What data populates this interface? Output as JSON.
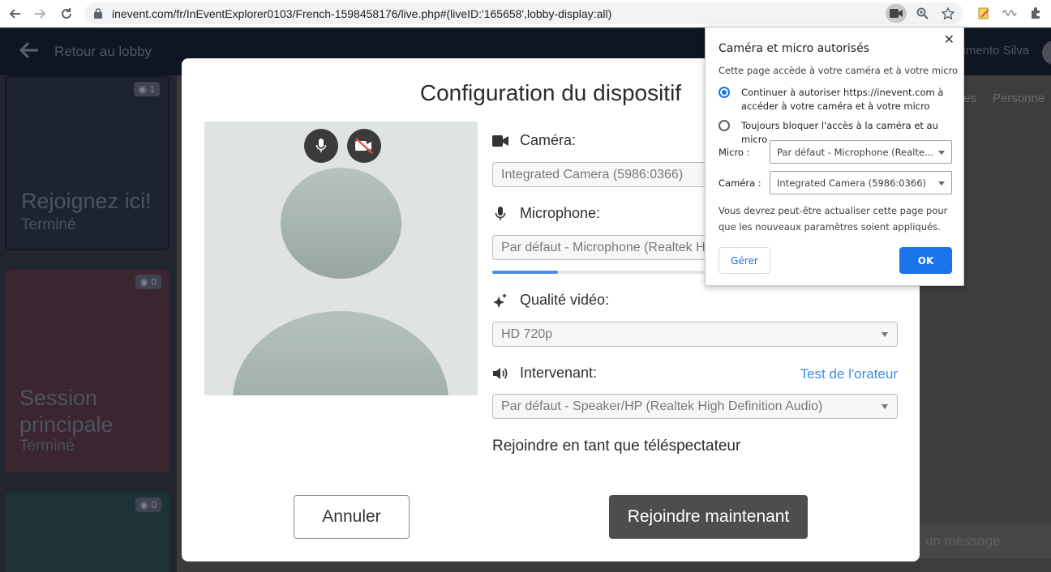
{
  "browser": {
    "url": "inevent.com/fr/InEventExplorer0103/French-1598458176/live.php#(liveID:'165658',lobby-display:all)"
  },
  "app": {
    "back_label": "Retour au lobby",
    "user_name": "cimento Silva",
    "rooms": [
      {
        "title": "Rejoignez ici!",
        "status": "Terminé",
        "viewers": "1"
      },
      {
        "title": "Session principale",
        "status": "Terminé",
        "viewers": "0"
      },
      {
        "title": "",
        "status": "",
        "viewers": "0"
      }
    ],
    "tabs": [
      "es",
      "Personne"
    ],
    "message_placeholder": "un message"
  },
  "modal": {
    "title": "Configuration du dispositif",
    "camera_label": "Caméra:",
    "camera_value": "Integrated Camera (5986:0366)",
    "microphone_label": "Microphone:",
    "microphone_value": "Par défaut - Microphone (Realtek Hi",
    "mic_level": 0.27,
    "quality_label": "Qualité vidéo:",
    "quality_value": "HD 720p",
    "speaker_label": "Intervenant:",
    "speaker_test": "Test de l'orateur",
    "speaker_value": "Par défaut - Speaker/HP (Realtek High Definition Audio)",
    "viewer_option": "Rejoindre en tant que téléspectateur",
    "cancel": "Annuler",
    "join": "Rejoindre maintenant"
  },
  "permission": {
    "title": "Caméra et micro autorisés",
    "description": "Cette page accède à votre caméra et à votre micro",
    "option_allow": "Continuer à autoriser https://inevent.com à accéder à votre caméra et à votre micro",
    "option_block": "Toujours bloquer l'accès à la caméra et au micro",
    "micro_label": "Micro :",
    "micro_value": "Par défaut - Microphone (Realte...",
    "camera_label": "Caméra :",
    "camera_value": "Integrated Camera (5986:0366)",
    "note": "Vous devrez peut-être actualiser cette page pour que les nouveaux paramètres soient appliqués.",
    "manage": "Gérer",
    "ok": "OK"
  },
  "colors": {
    "accent": "#1a73e8",
    "join_button": "#4d4d4d",
    "link": "#3d8de0"
  }
}
